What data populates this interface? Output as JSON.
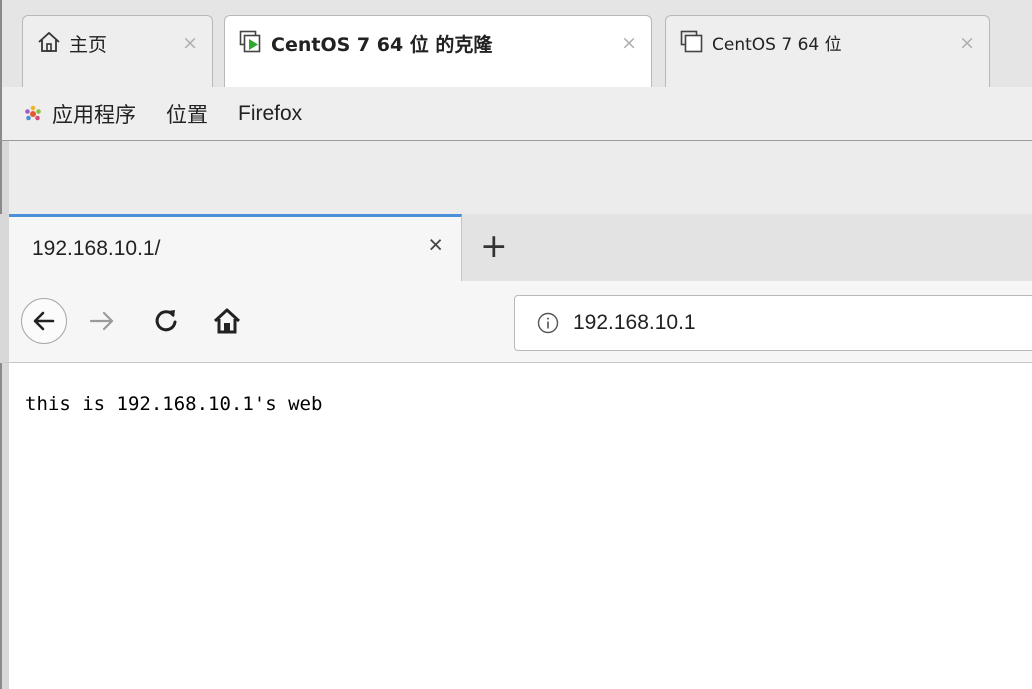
{
  "vm_tabs": [
    {
      "label": "主页",
      "close": "×",
      "icon": "home-icon"
    },
    {
      "label": "CentOS 7 64 位 的克隆",
      "close": "×",
      "icon": "vm-running-icon"
    },
    {
      "label": "CentOS 7 64 位",
      "close": "×",
      "icon": "vm-icon"
    }
  ],
  "gnome_bar": {
    "applications": "应用程序",
    "places": "位置",
    "firefox": "Firefox"
  },
  "firefox": {
    "tab_title": "192.168.10.1/",
    "tab_close": "×",
    "new_tab": "+",
    "url": "192.168.10.1",
    "accent_color": "#4a90d9"
  },
  "page": {
    "body_text": "this is 192.168.10.1's web"
  }
}
